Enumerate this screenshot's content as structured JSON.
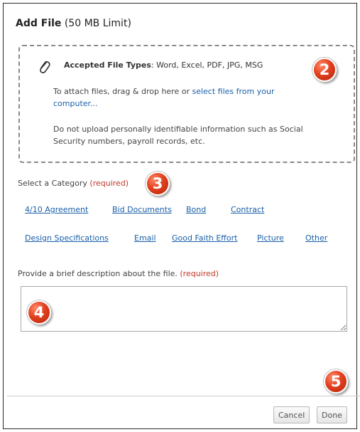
{
  "dialog": {
    "title_bold": "Add File",
    "title_rest": " (50 MB Limit)"
  },
  "dropzone": {
    "accepted_label": "Accepted File Types",
    "accepted_types": ": Word, Excel, PDF, JPG, MSG",
    "instruction_prefix": "To attach files, drag & drop here or ",
    "select_link": "select files from your computer...",
    "warning": "Do not upload personally identifiable information such as Social Security numbers, payroll records, etc."
  },
  "category": {
    "label": "Select a Category",
    "required": "(required)",
    "options": [
      "4/10 Agreement",
      "Bid Documents",
      "Bond",
      "Contract",
      "Design Specifications",
      "Email",
      "Good Faith Effort",
      "Picture",
      "Other"
    ]
  },
  "description": {
    "label": "Provide a brief description about the file.",
    "required": "(required)",
    "value": ""
  },
  "footer": {
    "cancel_label": "Cancel",
    "done_label": "Done"
  },
  "callouts": [
    "2",
    "3",
    "4",
    "5"
  ],
  "colors": {
    "link": "#1a5fa8",
    "required": "#c0392b",
    "callout": "#e2401f"
  }
}
